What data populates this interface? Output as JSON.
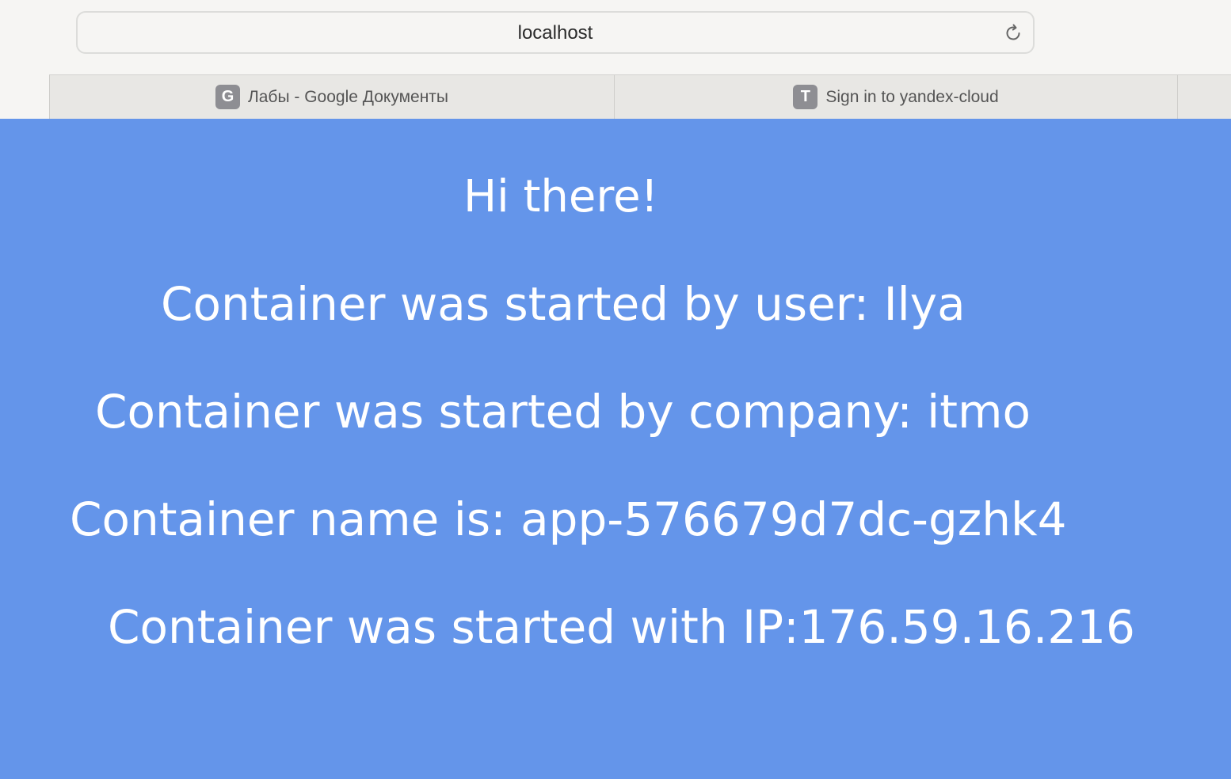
{
  "browser": {
    "address": "localhost",
    "tabs": [
      {
        "label": "Лабы - Google Документы",
        "favicon_letter": "G"
      },
      {
        "label": "Sign in to yandex-cloud",
        "favicon_letter": "T"
      }
    ]
  },
  "page": {
    "background": "#6495ea",
    "greeting": "Hi there!",
    "lines": [
      "Container was started by user: Ilya",
      "Container was started by company: itmo",
      "Container name is: app-576679d7dc-gzhk4",
      "Container was started with IP:176.59.16.216"
    ]
  }
}
